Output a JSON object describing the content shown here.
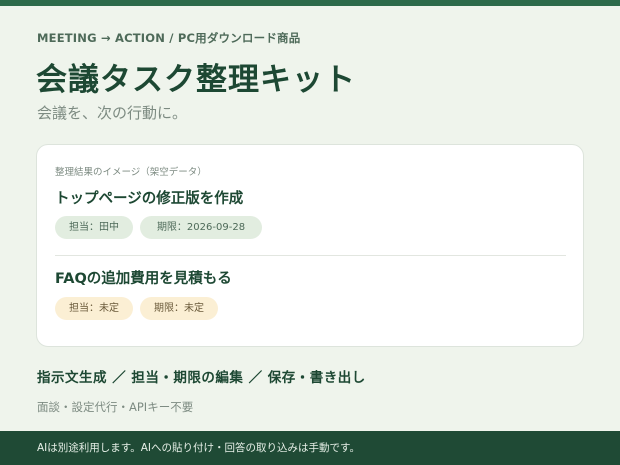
{
  "header": {
    "eyebrow": "MEETING → ACTION / PC用ダウンロード商品",
    "title": "会議タスク整理キット",
    "subtitle": "会議を、次の行動に。"
  },
  "card": {
    "caption": "整理結果のイメージ（架空データ）",
    "tasks": [
      {
        "title": "トップページの修正版を作成",
        "assignee": "担当：田中",
        "deadline": "期限：2026-09-28",
        "status_color": "green"
      },
      {
        "title": "FAQの追加費用を見積もる",
        "assignee": "担当：未定",
        "deadline": "期限：未定",
        "status_color": "amber"
      }
    ]
  },
  "features": "指示文生成 ／ 担当・期限の編集 ／ 保存・書き出し",
  "note": "面談・設定代行・APIキー不要",
  "footer": "AIは別途利用します。AIへの貼り付け・回答の取り込みは手動です。",
  "colors": {
    "brand": "#1f4a35",
    "background": "#eff4ec",
    "chip_green": "#e2ede0",
    "chip_amber": "#fbefd4"
  }
}
